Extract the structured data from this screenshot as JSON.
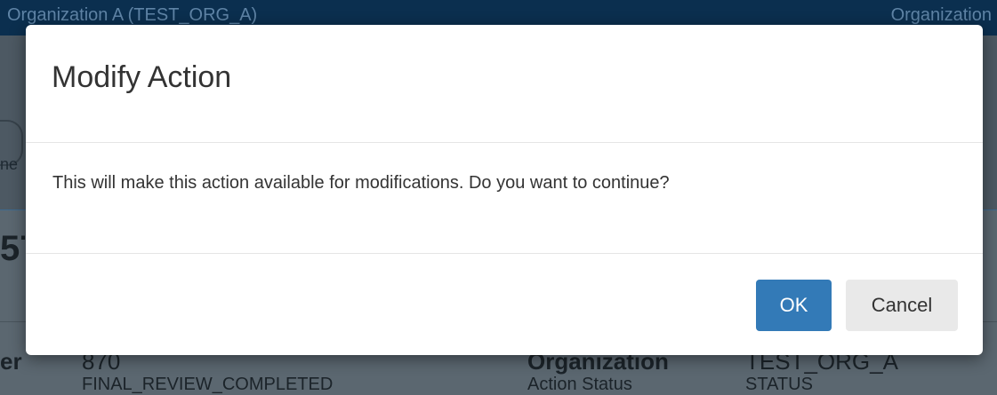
{
  "background": {
    "org_title": "Organization A (TEST_ORG_A)",
    "org_menu": "Organization",
    "left_fragment_1": "ne",
    "left_fragment_2": "57",
    "row": {
      "label_left": "er",
      "value_left": "870",
      "label_right": "Organization",
      "value_right": "TEST_ORG_A"
    },
    "row2": {
      "value_left": "FINAL_REVIEW_COMPLETED",
      "label_right": "Action Status",
      "value_right": "STATUS"
    }
  },
  "modal": {
    "title": "Modify Action",
    "message": "This will make this action available for modifications. Do you want to continue?",
    "ok_label": "OK",
    "cancel_label": "Cancel"
  },
  "colors": {
    "primary": "#337ab7",
    "topbar": "#0b2f4f"
  }
}
